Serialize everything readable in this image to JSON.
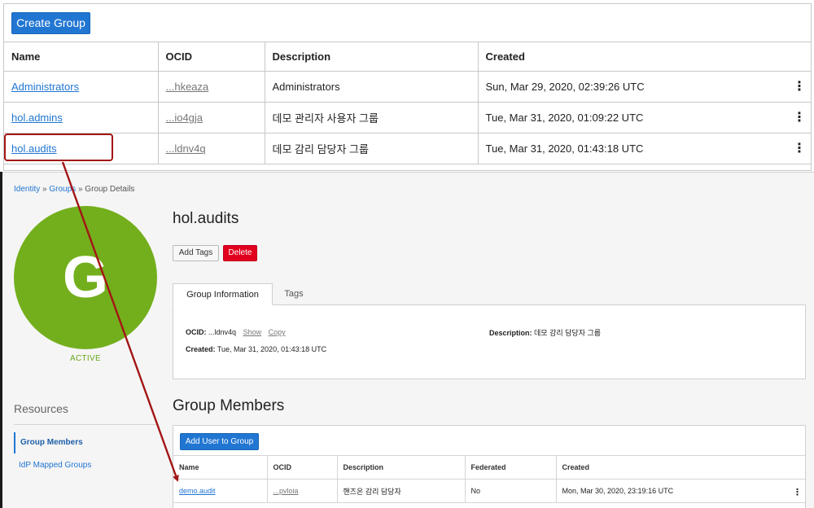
{
  "groups_panel": {
    "create_button": "Create Group",
    "columns": [
      "Name",
      "OCID",
      "Description",
      "Created"
    ],
    "rows": [
      {
        "name": "Administrators",
        "ocid": "...hkeaza",
        "description": "Administrators",
        "created": "Sun, Mar 29, 2020, 02:39:26 UTC"
      },
      {
        "name": "hol.admins",
        "ocid": "...io4gja",
        "description": "데모 관리자 사용자 그룹",
        "created": "Tue, Mar 31, 2020, 01:09:22 UTC"
      },
      {
        "name": "hol.audits",
        "ocid": "...ldnv4q",
        "description": "데모 감리 담당자 그룹",
        "created": "Tue, Mar 31, 2020, 01:43:18 UTC"
      }
    ],
    "kebab_icon": "⋮"
  },
  "details": {
    "breadcrumb": {
      "identity": "Identity",
      "sep1": " » ",
      "groups": "Groups",
      "sep2": " » ",
      "current": "Group Details"
    },
    "avatar_letter": "G",
    "avatar_color": "#73af1c",
    "status": "ACTIVE",
    "title": "hol.audits",
    "add_tags_button": "Add Tags",
    "delete_button": "Delete",
    "tabs": {
      "group_info": "Group Information",
      "tags": "Tags"
    },
    "info": {
      "ocid_label": "OCID:",
      "ocid_value": "...ldnv4q",
      "show_link": "Show",
      "copy_link": "Copy",
      "created_label": "Created:",
      "created_value": "Tue, Mar 31, 2020, 01:43:18 UTC",
      "description_label": "Description:",
      "description_value": "데모 감리 담당자 그룹"
    },
    "resources": {
      "heading": "Resources",
      "items": [
        "Group Members",
        "IdP Mapped Groups"
      ]
    },
    "members": {
      "heading": "Group Members",
      "add_button": "Add User to Group",
      "columns": [
        "Name",
        "OCID",
        "Description",
        "Federated",
        "Created"
      ],
      "rows": [
        {
          "name": "demo.audit",
          "ocid": "...pvloia",
          "description": "핸즈온 감리 담당자",
          "federated": "No",
          "created": "Mon, Mar 30, 2020, 23:19:16 UTC"
        }
      ]
    }
  },
  "annotation_color": "#a31515",
  "brand_blue": "#2176d2",
  "delete_red": "#e1001d"
}
